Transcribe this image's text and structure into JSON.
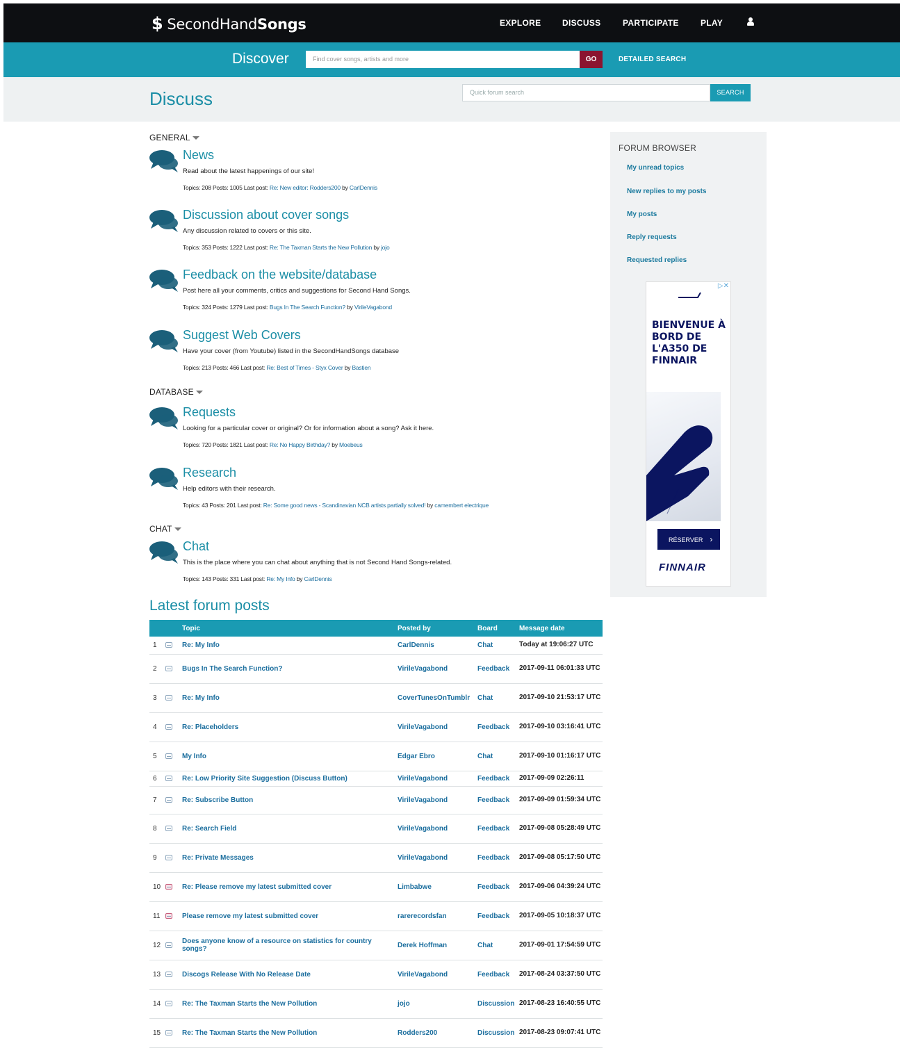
{
  "nav": {
    "logo_prefix": "SecondHand",
    "logo_bold": "Songs",
    "items": [
      "EXPLORE",
      "DISCUSS",
      "PARTICIPATE",
      "PLAY"
    ]
  },
  "discover": {
    "title": "Discover",
    "placeholder": "Find cover songs, artists and more",
    "go": "GO",
    "detailed": "DETAILED SEARCH"
  },
  "discuss": {
    "title": "Discuss",
    "search_placeholder": "Quick forum search",
    "search_button": "SEARCH"
  },
  "sections": [
    {
      "name": "GENERAL"
    },
    {
      "name": "DATABASE"
    },
    {
      "name": "CHAT"
    }
  ],
  "forums": [
    {
      "title": "News",
      "desc": "Read about the latest happenings of our site!",
      "stats": "Topics: 208 Posts: 1005 Last post:",
      "last": "Re: New editor: Rodders200",
      "by": "by",
      "author": "CarlDennis"
    },
    {
      "title": "Discussion about cover songs",
      "desc": "Any discussion related to covers or this site.",
      "stats": "Topics: 353 Posts: 1222 Last post:",
      "last": "Re: The Taxman Starts the New Pollution",
      "by": "by",
      "author": "jojo"
    },
    {
      "title": "Feedback on the website/database",
      "desc": "Post here all your comments, critics and suggestions for Second Hand Songs.",
      "stats": "Topics: 324 Posts: 1279 Last post:",
      "last": "Bugs In The Search Function?",
      "by": "by",
      "author": "VirileVagabond"
    },
    {
      "title": "Suggest Web Covers",
      "desc": "Have your cover (from Youtube) listed in the SecondHandSongs database",
      "stats": "Topics: 213 Posts: 466 Last post:",
      "last": "Re: Best of Times - Styx Cover",
      "by": "by",
      "author": "Bastien"
    },
    {
      "title": "Requests",
      "desc": "Looking for a particular cover or original? Or for information about a song? Ask it here.",
      "stats": "Topics: 720 Posts: 1821 Last post:",
      "last": "Re: No Happy Birthday?",
      "by": "by",
      "author": "Moebeus"
    },
    {
      "title": "Research",
      "desc": "Help editors with their research.",
      "stats": "Topics: 43 Posts: 201 Last post:",
      "last": "Re: Some good news - Scandinavian NCB artists partially solved!",
      "by": "by",
      "author": "camembert electrique"
    },
    {
      "title": "Chat",
      "desc": "This is the place where you can chat about anything that is not Second Hand Songs-related.",
      "stats": "Topics: 143 Posts: 331 Last post:",
      "last": "Re: My Info",
      "by": "by",
      "author": "CarlDennis"
    }
  ],
  "sidebar": {
    "title": "FORUM BROWSER",
    "links": [
      "My unread topics",
      "New replies to my posts",
      "My posts",
      "Reply requests",
      "Requested replies"
    ],
    "ad": {
      "headline": "BIENVENUE À BORD DE L'A350 DE FINNAIR",
      "button": "RÉSERVER",
      "brand": "FINNAIR"
    }
  },
  "latest": {
    "title": "Latest forum posts",
    "headers": [
      "Topic",
      "Posted by",
      "Board",
      "Message date"
    ],
    "rows": [
      {
        "n": "1",
        "topic": "Re: My Info",
        "by": "CarlDennis",
        "board": "Chat",
        "date": "Today at 19:06:27 UTC"
      },
      {
        "n": "2",
        "topic": "Bugs In The Search Function?",
        "by": "VirileVagabond",
        "board": "Feedback",
        "date": "2017-09-11 06:01:33 UTC"
      },
      {
        "n": "3",
        "topic": "Re: My Info",
        "by": "CoverTunesOnTumblr",
        "board": "Chat",
        "date": "2017-09-10 21:53:17 UTC"
      },
      {
        "n": "4",
        "topic": "Re: Placeholders",
        "by": "VirileVagabond",
        "board": "Feedback",
        "date": "2017-09-10 03:16:41 UTC"
      },
      {
        "n": "5",
        "topic": "My Info",
        "by": "Edgar Ebro",
        "board": "Chat",
        "date": "2017-09-10 01:16:17 UTC"
      },
      {
        "n": "6",
        "topic": "Re: Low Priority Site Suggestion (Discuss Button)",
        "by": "VirileVagabond",
        "board": "Feedback",
        "date": "2017-09-09 02:26:11"
      },
      {
        "n": "7",
        "topic": "Re: Subscribe Button",
        "by": "VirileVagabond",
        "board": "Feedback",
        "date": "2017-09-09 01:59:34 UTC"
      },
      {
        "n": "8",
        "topic": "Re: Search Field",
        "by": "VirileVagabond",
        "board": "Feedback",
        "date": "2017-09-08 05:28:49 UTC"
      },
      {
        "n": "9",
        "topic": "Re: Private Messages",
        "by": "VirileVagabond",
        "board": "Feedback",
        "date": "2017-09-08 05:17:50 UTC"
      },
      {
        "n": "10",
        "topic": "Re: Please remove my latest submitted cover",
        "by": "Limbabwe",
        "board": "Feedback",
        "date": "2017-09-06 04:39:24 UTC"
      },
      {
        "n": "11",
        "topic": "Please remove my latest submitted cover",
        "by": "rarerecordsfan",
        "board": "Feedback",
        "date": "2017-09-05 10:18:37 UTC"
      },
      {
        "n": "12",
        "topic": "Does anyone know of a resource on statistics for country songs?",
        "by": "Derek Hoffman",
        "board": "Chat",
        "date": "2017-09-01 17:54:59 UTC"
      },
      {
        "n": "13",
        "topic": "Discogs Release With No Release Date",
        "by": "VirileVagabond",
        "board": "Feedback",
        "date": "2017-08-24 03:37:50 UTC"
      },
      {
        "n": "14",
        "topic": "Re: The Taxman Starts the New Pollution",
        "by": "jojo",
        "board": "Discussion",
        "date": "2017-08-23 16:40:55 UTC"
      },
      {
        "n": "15",
        "topic": "Re: The Taxman Starts the New Pollution",
        "by": "Rodders200",
        "board": "Discussion",
        "date": "2017-08-23 09:07:41 UTC"
      }
    ]
  },
  "colors": {
    "teal": "#1a9bb3",
    "dark": "#0d0f12",
    "go": "#8b1430",
    "link": "#1b6e9e"
  }
}
